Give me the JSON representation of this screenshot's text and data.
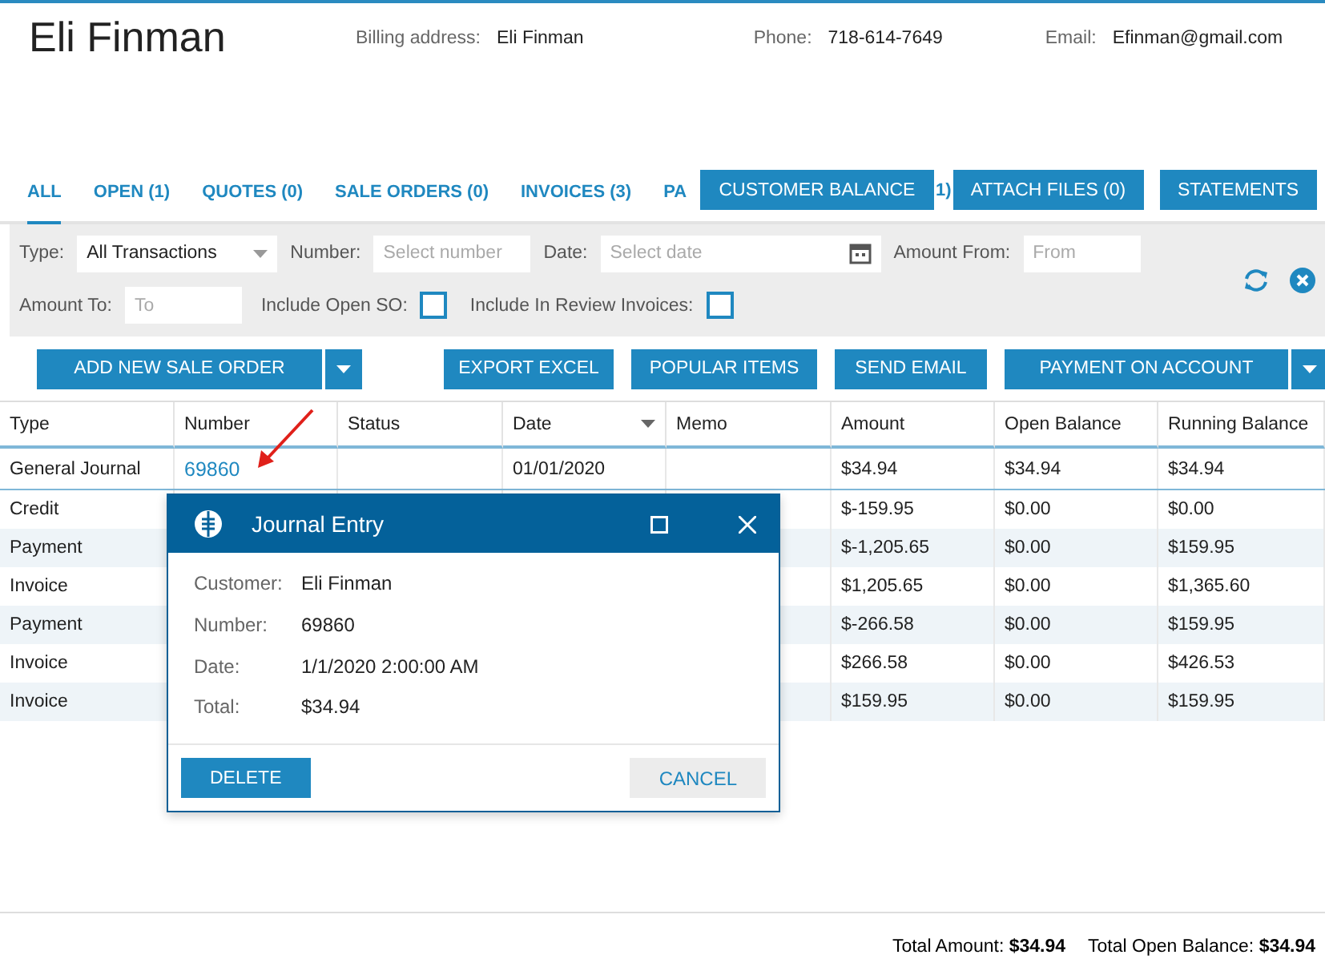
{
  "customer": {
    "name": "Eli Finman",
    "billing_label": "Billing address:",
    "billing_value": "Eli Finman",
    "phone_label": "Phone:",
    "phone_value": "718-614-7649",
    "email_label": "Email:",
    "email_value": "Efinman@gmail.com"
  },
  "tabs": [
    {
      "label": "ALL",
      "selected": true
    },
    {
      "label": "OPEN (1)",
      "selected": false
    },
    {
      "label": "QUOTES (0)",
      "selected": false
    },
    {
      "label": "SALE ORDERS (0)",
      "selected": false
    },
    {
      "label": "INVOICES (3)",
      "selected": false
    },
    {
      "label": "PA",
      "selected": false
    }
  ],
  "hidden_tab_tail": "1)",
  "top_buttons": [
    "CUSTOMER BALANCE",
    "ATTACH FILES (0)",
    "STATEMENTS"
  ],
  "filters": {
    "type_label": "Type:",
    "type_value": "All Transactions",
    "number_label": "Number:",
    "number_placeholder": "Select number",
    "date_label": "Date:",
    "date_placeholder": "Select date",
    "amount_from_label": "Amount From:",
    "amount_from_placeholder": "From",
    "amount_to_label": "Amount To:",
    "amount_to_placeholder": "To",
    "open_so_label": "Include Open SO:",
    "open_so_checked": false,
    "review_label": "Include In Review Invoices:",
    "review_checked": false
  },
  "action_buttons": [
    {
      "label": "ADD NEW SALE ORDER",
      "dropdown": true
    },
    {
      "label": "EXPORT EXCEL",
      "dropdown": false
    },
    {
      "label": "POPULAR ITEMS",
      "dropdown": false
    },
    {
      "label": "SEND EMAIL",
      "dropdown": false
    },
    {
      "label": "PAYMENT ON ACCOUNT",
      "dropdown": true
    }
  ],
  "table": {
    "columns": [
      {
        "label": "Type",
        "sorted": false
      },
      {
        "label": "Number",
        "sorted": false
      },
      {
        "label": "Status",
        "sorted": false
      },
      {
        "label": "Date",
        "sorted": true
      },
      {
        "label": "Memo",
        "sorted": false
      },
      {
        "label": "Amount",
        "sorted": false
      },
      {
        "label": "Open Balance",
        "sorted": false
      },
      {
        "label": "Running Balance",
        "sorted": false
      }
    ],
    "rows": [
      {
        "type": "General Journal",
        "number": "69860",
        "date": "01/01/2020",
        "amount": "$34.94",
        "open_balance": "$34.94",
        "running_balance": "$34.94"
      },
      {
        "type": "Credit",
        "amount": "$-159.95",
        "open_balance": "$0.00",
        "running_balance": "$0.00"
      },
      {
        "type": "Payment",
        "amount": "$-1,205.65",
        "open_balance": "$0.00",
        "running_balance": "$159.95"
      },
      {
        "type": "Invoice",
        "amount": "$1,205.65",
        "open_balance": "$0.00",
        "running_balance": "$1,365.60"
      },
      {
        "type": "Payment",
        "amount": "$-266.58",
        "open_balance": "$0.00",
        "running_balance": "$159.95"
      },
      {
        "type": "Invoice",
        "amount": "$266.58",
        "open_balance": "$0.00",
        "running_balance": "$426.53"
      },
      {
        "type": "Invoice",
        "amount": "$159.95",
        "open_balance": "$0.00",
        "running_balance": "$159.95"
      }
    ]
  },
  "dialog": {
    "title": "Journal Entry",
    "fields": [
      {
        "label": "Customer:",
        "value": "Eli Finman"
      },
      {
        "label": "Number:",
        "value": "69860"
      },
      {
        "label": "Date:",
        "value": "1/1/2020 2:00:00 AM"
      },
      {
        "label": "Total:",
        "value": "$34.94"
      }
    ],
    "delete_button": "DELETE",
    "cancel_button": "CANCEL"
  },
  "totals": {
    "amount_label": "Total Amount:",
    "amount_value": "$34.94",
    "open_label": "Total Open Balance:",
    "open_value": "$34.94"
  }
}
